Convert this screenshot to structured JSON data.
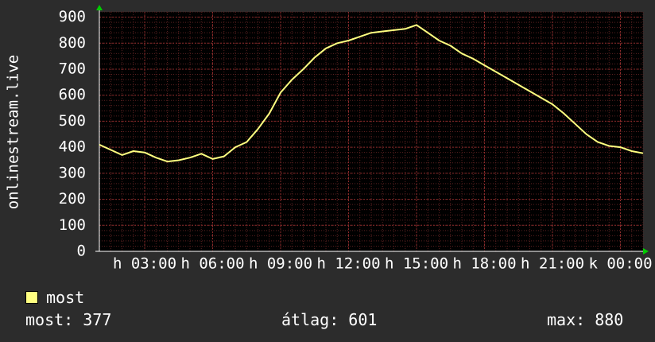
{
  "chart_data": {
    "type": "line",
    "ylabel": "onlinestream.live",
    "yticks": [
      0,
      100,
      200,
      300,
      400,
      500,
      600,
      700,
      800,
      900
    ],
    "ylim": [
      0,
      920
    ],
    "xlim": [
      0,
      24
    ],
    "xticks": [
      {
        "pos": 2,
        "label": "h 03:00"
      },
      {
        "pos": 5,
        "label": "h 06:00"
      },
      {
        "pos": 8,
        "label": "h 09:00"
      },
      {
        "pos": 11,
        "label": "h 12:00"
      },
      {
        "pos": 14,
        "label": "h 15:00"
      },
      {
        "pos": 17,
        "label": "h 18:00"
      },
      {
        "pos": 20,
        "label": "h 21:00"
      },
      {
        "pos": 23,
        "label": "k 00:00"
      }
    ],
    "grid": true,
    "series": [
      {
        "name": "most",
        "color": "#ffff80",
        "x": [
          0,
          0.5,
          1,
          1.5,
          2,
          2.5,
          3,
          3.5,
          4,
          4.5,
          5,
          5.5,
          6,
          6.5,
          7,
          7.5,
          8,
          8.5,
          9,
          9.5,
          10,
          10.5,
          11,
          11.5,
          12,
          12.5,
          13,
          13.5,
          14,
          14.5,
          15,
          15.5,
          16,
          16.5,
          17,
          17.5,
          18,
          18.5,
          19,
          19.5,
          20,
          20.5,
          21,
          21.5,
          22,
          22.5,
          23,
          23.5,
          24
        ],
        "values": [
          410,
          390,
          370,
          385,
          380,
          360,
          345,
          350,
          360,
          375,
          355,
          365,
          400,
          420,
          470,
          530,
          610,
          660,
          700,
          745,
          780,
          800,
          810,
          825,
          840,
          845,
          850,
          855,
          870,
          840,
          810,
          790,
          760,
          740,
          715,
          690,
          665,
          640,
          615,
          590,
          565,
          530,
          490,
          450,
          420,
          405,
          400,
          385,
          377
        ]
      }
    ]
  },
  "legend": {
    "label": "most",
    "color": "#ffff80"
  },
  "stats": {
    "current": "most: 377",
    "average": "átlag: 601",
    "maximum": "max: 880"
  }
}
